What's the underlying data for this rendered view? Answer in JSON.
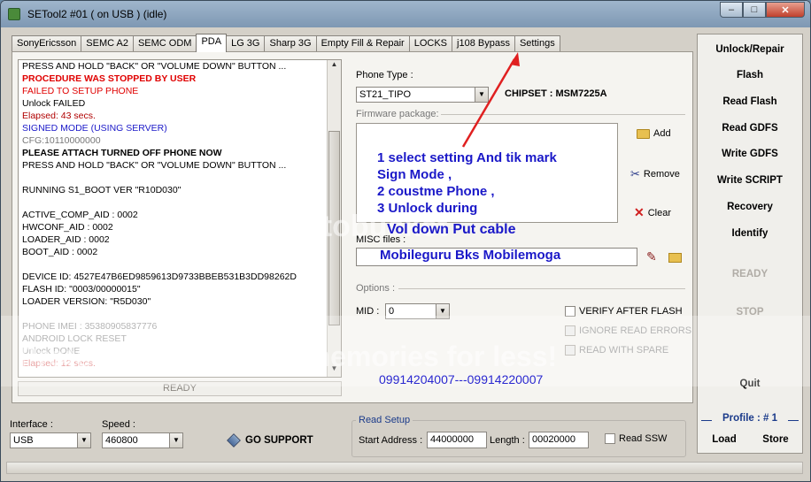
{
  "window": {
    "title": "SETool2 #01 ( on USB ) (idle)",
    "min_glyph": "–",
    "max_glyph": "□",
    "close_glyph": "✕"
  },
  "tabs": [
    "SonyEricsson",
    "SEMC A2",
    "SEMC ODM",
    "PDA",
    "LG 3G",
    "Sharp 3G",
    "Empty Fill & Repair",
    "LOCKS",
    "j108 Bypass",
    "Settings"
  ],
  "log": {
    "lines": [
      {
        "text": "PRESS AND HOLD \"BACK\" OR \"VOLUME DOWN\" BUTTON ...",
        "color": "#000000",
        "bold": false
      },
      {
        "text": "PROCEDURE WAS STOPPED BY USER",
        "color": "#e00000",
        "bold": true
      },
      {
        "text": "FAILED TO SETUP PHONE",
        "color": "#e00000",
        "bold": false
      },
      {
        "text": "Unlock FAILED",
        "color": "#000000",
        "bold": false
      },
      {
        "text": "Elapsed: 43 secs.",
        "color": "#b00000",
        "bold": false
      },
      {
        "text": "SIGNED MODE (USING SERVER)",
        "color": "#1a18c8",
        "bold": false
      },
      {
        "text": "CFG:10110000000",
        "color": "#777777",
        "bold": false
      },
      {
        "text": "PLEASE ATTACH TURNED OFF PHONE NOW",
        "color": "#000000",
        "bold": true
      },
      {
        "text": "PRESS AND HOLD \"BACK\" OR \"VOLUME DOWN\" BUTTON ...",
        "color": "#000000",
        "bold": false
      },
      {
        "text": "",
        "color": "#000000",
        "bold": false
      },
      {
        "text": "RUNNING S1_BOOT VER \"R10D030\"",
        "color": "#000000",
        "bold": false
      },
      {
        "text": "",
        "color": "#000000",
        "bold": false
      },
      {
        "text": "ACTIVE_COMP_AID : 0002",
        "color": "#000000",
        "bold": false
      },
      {
        "text": "HWCONF_AID : 0002",
        "color": "#000000",
        "bold": false
      },
      {
        "text": "LOADER_AID : 0002",
        "color": "#000000",
        "bold": false
      },
      {
        "text": "BOOT_AID : 0002",
        "color": "#000000",
        "bold": false
      },
      {
        "text": "",
        "color": "#000000",
        "bold": false
      },
      {
        "text": "DEVICE ID: 4527E47B6ED9859613D9733BBEB531B3DD98262D",
        "color": "#000000",
        "bold": false
      },
      {
        "text": "FLASH ID: \"0003/00000015\"",
        "color": "#000000",
        "bold": false
      },
      {
        "text": "LOADER VERSION: \"R5D030\"",
        "color": "#000000",
        "bold": false
      },
      {
        "text": "",
        "color": "#000000",
        "bold": false
      },
      {
        "text": "PHONE IMEI : 35380905837776",
        "color": "#999999",
        "bold": false
      },
      {
        "text": "ANDROID LOCK RESET",
        "color": "#999999",
        "bold": false
      },
      {
        "text": "Unlock DONE",
        "color": "#999999",
        "bold": false
      },
      {
        "text": "Elapsed: 12 secs.",
        "color": "#e08080",
        "bold": false
      }
    ],
    "status": "READY"
  },
  "pda": {
    "phone_type_label": "Phone Type :",
    "phone_type_value": "ST21_TIPO",
    "chipset": "CHIPSET : MSM7225A",
    "firmware_label": "Firmware package:",
    "add_label": "Add",
    "remove_label": "Remove",
    "clear_label": "Clear",
    "misc_label": "MISC files :",
    "options_label": "Options :",
    "mid_label": "MID :",
    "mid_value": "0",
    "verify_label": "VERIFY AFTER FLASH",
    "ignore_label": "IGNORE READ ERRORS",
    "readspare_label": "READ WITH SPARE"
  },
  "annotations": {
    "note1": "1  select setting  And tik mark",
    "note2": "Sign Mode ,",
    "note3": "2 coustme Phone ,",
    "note4": "3 Unlock during",
    "note5": "Vol down Put cable",
    "misc_text": "Mobileguru Bks Mobilemoga",
    "phones": "09914204007---09914220007",
    "arrow_color": "#e02020"
  },
  "right_panel": {
    "buttons": [
      "Unlock/Repair",
      "Flash",
      "Read Flash",
      "Read GDFS",
      "Write GDFS",
      "Write SCRIPT",
      "Recovery",
      "Identify"
    ],
    "ready": "READY",
    "stop": "STOP",
    "quit": "Quit",
    "profile": "Profile : # 1",
    "load": "Load",
    "store": "Store"
  },
  "bottom": {
    "interface_label": "Interface :",
    "interface_value": "USB",
    "speed_label": "Speed :",
    "speed_value": "460800",
    "go_support": "GO SUPPORT",
    "read_setup_label": "Read Setup",
    "start_address_label": "Start Address :",
    "start_address_value": "44000000",
    "length_label": "Length :",
    "length_value": "00020000",
    "read_ssw_label": "Read SSW"
  },
  "watermark": {
    "text1": "otobucket",
    "text2": "Protect more of your memories for less!"
  }
}
